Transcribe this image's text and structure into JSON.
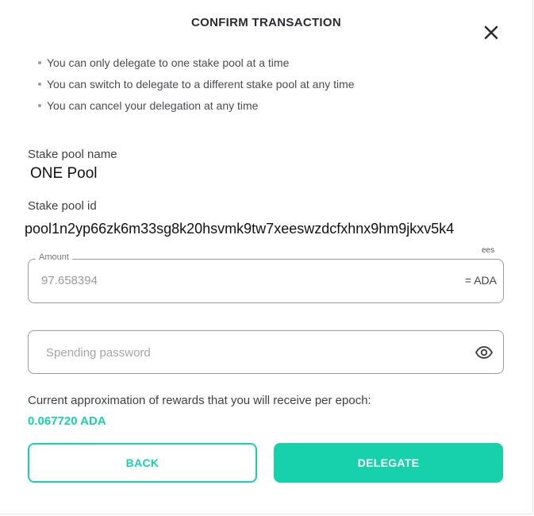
{
  "dialog": {
    "title": "CONFIRM TRANSACTION",
    "close_icon": "close-icon"
  },
  "notes": [
    "You can only delegate to one stake pool at a time",
    "You can switch to delegate to a different stake pool at any time",
    "You can cancel your delegation at any time"
  ],
  "pool": {
    "name_label": "Stake pool name",
    "name": "ONE Pool",
    "id_label": "Stake pool id",
    "id": "pool1n2yp66zk6m33sg8k20hsvmk9tw7xeeswzdcfxhnx9hm9jkxv5k4"
  },
  "amount": {
    "legend": "Amount",
    "value": "97.658394",
    "suffix": "= ADA",
    "fees_hint": "ees"
  },
  "password": {
    "placeholder": "Spending password",
    "eye_icon": "eye-icon"
  },
  "rewards": {
    "text": "Current approximation of rewards that you will receive per epoch:",
    "value": "0.067720 ADA"
  },
  "buttons": {
    "back": "BACK",
    "delegate": "DELEGATE"
  },
  "colors": {
    "accent": "#17d1aa",
    "text": "#38393d",
    "border": "#9b9b9b"
  }
}
